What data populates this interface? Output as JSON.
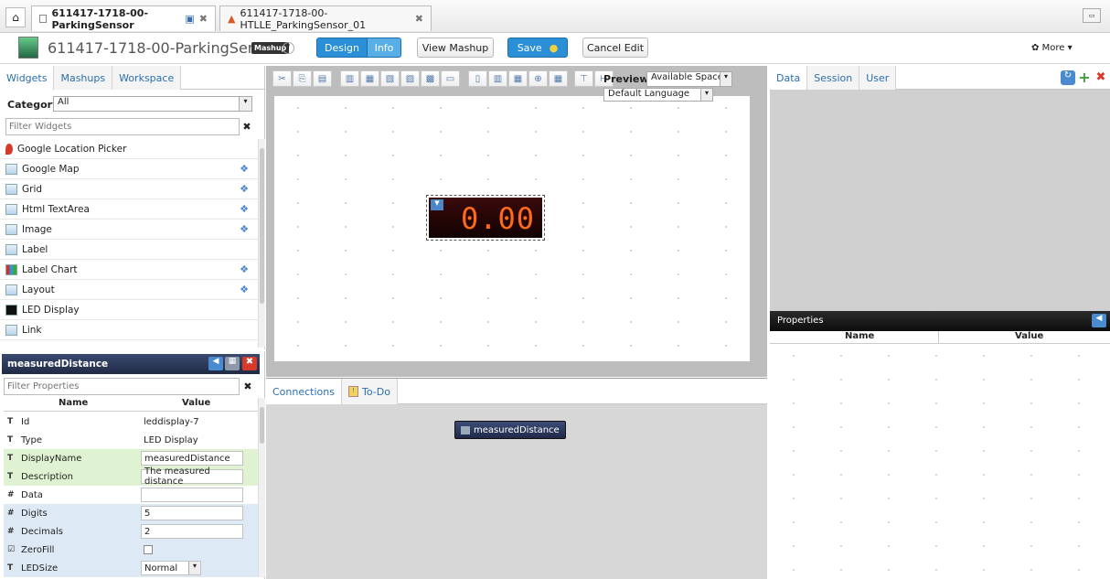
{
  "browser": {
    "tab1": "611417-1718-00-ParkingSensor",
    "tab2": "611417-1718-00-HTLLE_ParkingSensor_01"
  },
  "header": {
    "title": "611417-1718-00-ParkingSensor",
    "badge": "Mashup",
    "design": "Design",
    "info": "Info",
    "view_mashup": "View Mashup",
    "save": "Save",
    "cancel": "Cancel Edit",
    "more": "More"
  },
  "left": {
    "tabs": [
      "Widgets",
      "Mashups",
      "Workspace"
    ],
    "category_label": "Category",
    "category_value": "All",
    "filter_placeholder": "Filter Widgets",
    "widgets": [
      {
        "label": "Google Location Picker",
        "icon": "location-pin-icon",
        "puzzle": false
      },
      {
        "label": "Google Map",
        "icon": "map-icon",
        "puzzle": true
      },
      {
        "label": "Grid",
        "icon": "grid-icon",
        "puzzle": true
      },
      {
        "label": "Html TextArea",
        "icon": "textarea-icon",
        "puzzle": true
      },
      {
        "label": "Image",
        "icon": "image-icon",
        "puzzle": true
      },
      {
        "label": "Label",
        "icon": "label-icon",
        "puzzle": false
      },
      {
        "label": "Label Chart",
        "icon": "chart-icon",
        "puzzle": true
      },
      {
        "label": "Layout",
        "icon": "layout-icon",
        "puzzle": true
      },
      {
        "label": "LED Display",
        "icon": "led-icon",
        "puzzle": false
      },
      {
        "label": "Link",
        "icon": "link-icon",
        "puzzle": false
      }
    ]
  },
  "props": {
    "title": "measuredDistance",
    "filter_placeholder": "Filter Properties",
    "col_name": "Name",
    "col_value": "Value",
    "rows": [
      {
        "name": "Id",
        "value": "leddisplay-7",
        "box": false,
        "bg": ""
      },
      {
        "name": "Type",
        "value": "LED Display",
        "box": false,
        "bg": ""
      },
      {
        "name": "DisplayName",
        "value": "measuredDistance",
        "box": true,
        "bg": "green"
      },
      {
        "name": "Description",
        "value": "The measured distance",
        "box": true,
        "bg": "green"
      },
      {
        "name": "Data",
        "value": "",
        "box": true,
        "bg": ""
      },
      {
        "name": "Digits",
        "value": "5",
        "box": true,
        "bg": "blue"
      },
      {
        "name": "Decimals",
        "value": "2",
        "box": true,
        "bg": "blue"
      },
      {
        "name": "ZeroFill",
        "value": "",
        "box": false,
        "bg": "blue"
      },
      {
        "name": "LEDSize",
        "value": "Normal",
        "box": true,
        "bg": "blue"
      }
    ]
  },
  "center": {
    "preview_label": "Preview",
    "preview_value": "Available Space",
    "language": "Default Language",
    "led_value": "0.00",
    "tabs": [
      "Connections",
      "To-Do"
    ],
    "node_label": "measuredDistance"
  },
  "right": {
    "tabs": [
      "Data",
      "Session",
      "User"
    ],
    "props_title": "Properties",
    "col_name": "Name",
    "col_value": "Value"
  },
  "colors": {
    "accent": "#2a8fd6",
    "panel_dark": "#1f2a44",
    "led": "#ff6a1a"
  }
}
